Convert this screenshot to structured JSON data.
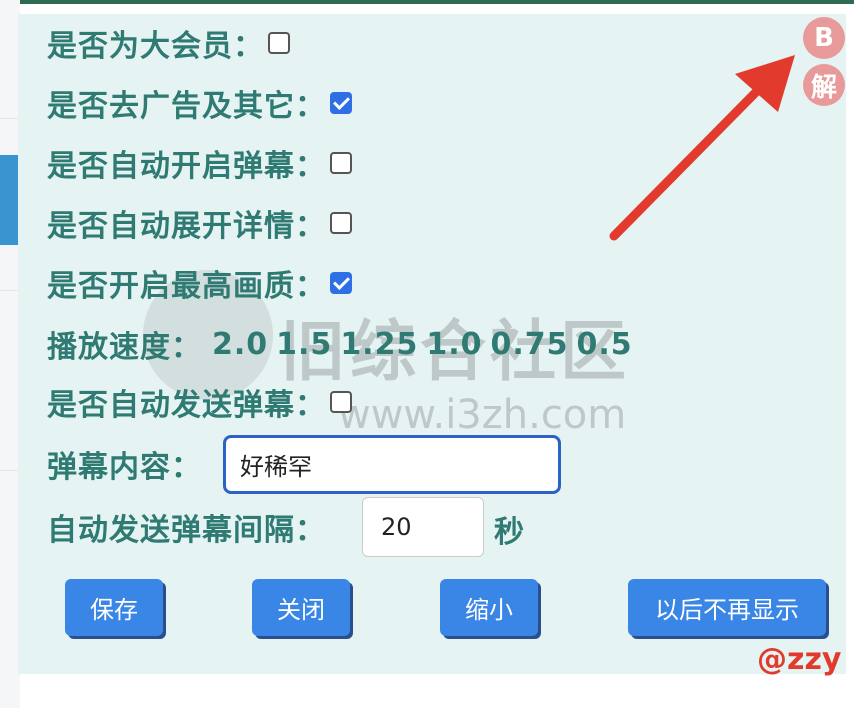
{
  "options": [
    {
      "label": "是否为大会员：",
      "checked": false
    },
    {
      "label": "是否去广告及其它：",
      "checked": true
    },
    {
      "label": "是否自动开启弹幕：",
      "checked": false
    },
    {
      "label": "是否自动展开详情：",
      "checked": false
    },
    {
      "label": "是否开启最高画质：",
      "checked": true
    }
  ],
  "speed": {
    "label": "播放速度：",
    "values": [
      "2.0",
      "1.5",
      "1.25",
      "1.0",
      "0.75",
      "0.5"
    ]
  },
  "auto_send": {
    "label": "是否自动发送弹幕：",
    "checked": false
  },
  "danmaku_content": {
    "label": "弹幕内容：",
    "value": "好稀罕"
  },
  "interval": {
    "label": "自动发送弹幕间隔：",
    "value": "20",
    "unit": "秒"
  },
  "buttons": {
    "save": "保存",
    "close": "关闭",
    "minimize": "缩小",
    "never_show": "以后不再显示"
  },
  "corner": {
    "b_label": "B",
    "jie_label": "解"
  },
  "watermark": {
    "name": "旧综合社区",
    "url": "www.i3zh.com"
  },
  "author_tag": "@zzy",
  "colors": {
    "panel_bg": "#e5f3f3",
    "label_text": "#2f7a72",
    "button_bg": "#3a86e6",
    "checkbox_checked": "#2f6fe6",
    "arrow": "#e23b2e",
    "corner_badge": "#e89a9a"
  }
}
